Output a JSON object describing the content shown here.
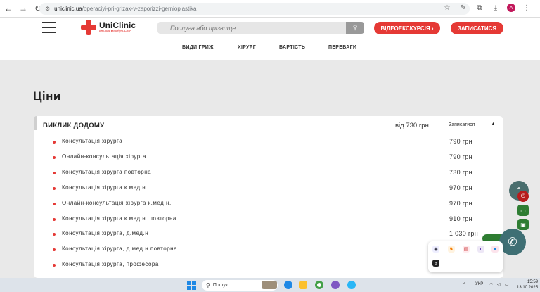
{
  "browser": {
    "url_host": "uniclinic.ua",
    "url_path": "/operaciyi-pri-grizax-v-zaporizzi-gernioplastika",
    "avatar_letter": "A"
  },
  "header": {
    "logo_name": "UniClinic",
    "logo_tagline": "клініка майбутнього",
    "search_placeholder": "Послуга або прізвище",
    "tour_button": "ВІДЕОЕКСКУРСІЯ ›",
    "signup_button": "ЗАПИСАТИСЯ"
  },
  "anchors": [
    "ВИДИ ГРИЖ",
    "ХІРУРГ",
    "ВАРТІСТЬ",
    "ПЕРЕВАГИ"
  ],
  "page": {
    "title": "Ціни"
  },
  "price_card": {
    "title": "ВИКЛИК ДОДОМУ",
    "from_price": "від 730 грн",
    "signup_link": "Записатися",
    "collapse_arrow": "▲",
    "items": [
      {
        "name": "Консультація хірурга",
        "price": "790 грн"
      },
      {
        "name": "Онлайн-консультація хірурга",
        "price": "790 грн"
      },
      {
        "name": "Консультація хірурга повторна",
        "price": "730 грн"
      },
      {
        "name": "Консультація хірурга к.мед.н.",
        "price": "970 грн"
      },
      {
        "name": "Онлайн-консультація хірурга к.мед.н.",
        "price": "970 грн"
      },
      {
        "name": "Консультація хірурга к.мед.н. повторна",
        "price": "910 грн"
      },
      {
        "name": "Консультація хірурга, д.мед.н",
        "price": "1 030 грн"
      },
      {
        "name": "Консультація хірурга, д.мед.н повторна",
        "price": ""
      },
      {
        "name": "Консультація хірурга, професора",
        "price": ""
      }
    ]
  },
  "taskbar": {
    "search_label": "Пошук",
    "language": "УКР",
    "time": "15:59",
    "date": "13.10.2025"
  },
  "colors": {
    "brand_red": "#e53935",
    "teal": "#3f6f74",
    "green": "#2e7d32"
  }
}
